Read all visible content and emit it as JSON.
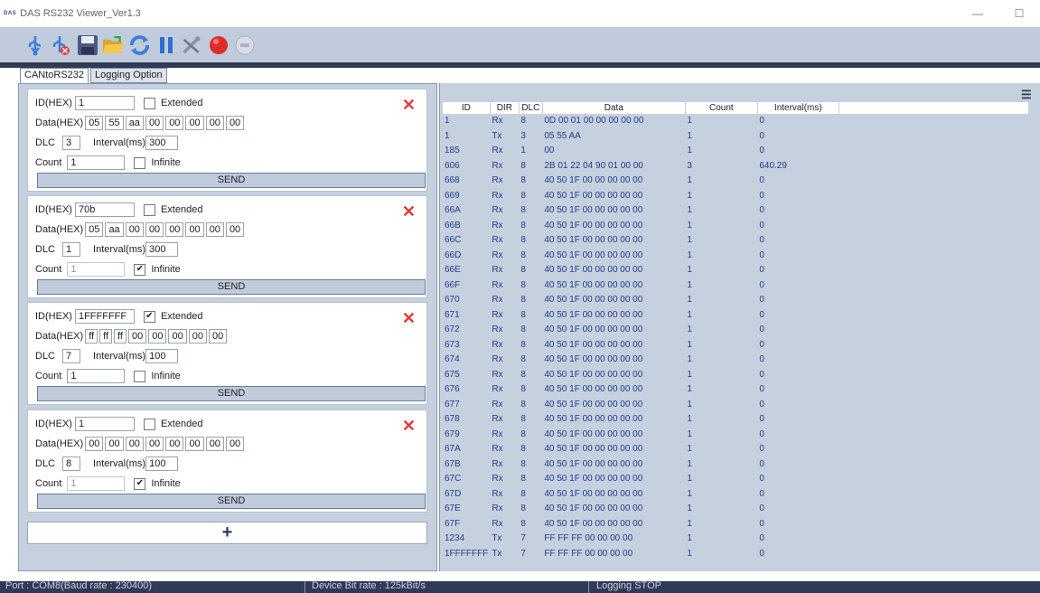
{
  "window": {
    "logo": "DAS",
    "title": "DAS RS232 Viewer_Ver1.3",
    "minimize": "—",
    "maximize": "☐"
  },
  "toolbar": {
    "items": [
      "usb-connect-icon",
      "usb-disconnect-icon",
      "save-icon",
      "open-folder-icon",
      "refresh-icon",
      "pause-icon",
      "tools-icon",
      "record-icon",
      "stop-record-icon"
    ]
  },
  "tabs": [
    "CANtoRS232",
    "Logging Option"
  ],
  "messages": [
    {
      "id_label": "ID(HEX)",
      "id": "1",
      "extended": false,
      "extended_label": "Extended",
      "data_label": "Data(HEX)",
      "data": [
        "05",
        "55",
        "aa",
        "00",
        "00",
        "00",
        "00",
        "00"
      ],
      "dlc_label": "DLC",
      "dlc": "3",
      "interval_label": "Interval(ms)",
      "interval": "300",
      "count_label": "Count",
      "count": "1",
      "infinite": false,
      "infinite_label": "Infinite",
      "send": "SEND",
      "close": "✕"
    },
    {
      "id_label": "ID(HEX)",
      "id": "70b",
      "extended": false,
      "extended_label": "Extended",
      "data_label": "Data(HEX)",
      "data": [
        "05",
        "aa",
        "00",
        "00",
        "00",
        "00",
        "00",
        "00"
      ],
      "dlc_label": "DLC",
      "dlc": "1",
      "interval_label": "Interval(ms)",
      "interval": "300",
      "count_label": "Count",
      "count": "1",
      "infinite": true,
      "infinite_label": "Infinite",
      "send": "SEND",
      "close": "✕"
    },
    {
      "id_label": "ID(HEX)",
      "id": "1FFFFFFF",
      "extended": true,
      "extended_label": "Extended",
      "data_label": "Data(HEX)",
      "data": [
        "ff",
        "ff",
        "ff",
        "00",
        "00",
        "00",
        "00",
        "00"
      ],
      "dlc_label": "DLC",
      "dlc": "7",
      "interval_label": "Interval(ms)",
      "interval": "100",
      "count_label": "Count",
      "count": "1",
      "infinite": false,
      "infinite_label": "Infinite",
      "send": "SEND",
      "close": "✕"
    },
    {
      "id_label": "ID(HEX)",
      "id": "1",
      "extended": false,
      "extended_label": "Extended",
      "data_label": "Data(HEX)",
      "data": [
        "00",
        "00",
        "00",
        "00",
        "00",
        "00",
        "00",
        "00"
      ],
      "dlc_label": "DLC",
      "dlc": "8",
      "interval_label": "Interval(ms)",
      "interval": "100",
      "count_label": "Count",
      "count": "1",
      "infinite": true,
      "infinite_label": "Infinite",
      "send": "SEND",
      "close": "✕"
    }
  ],
  "add_button": "+",
  "log": {
    "columns": [
      "ID",
      "DIR",
      "DLC",
      "Data",
      "Count",
      "Interval(ms)"
    ],
    "rows": [
      [
        "1",
        "Rx",
        "8",
        "0D 00 01 00 00 00 00 00",
        "1",
        "0"
      ],
      [
        "1",
        "Tx",
        "3",
        "05 55 AA",
        "1",
        "0"
      ],
      [
        "185",
        "Rx",
        "1",
        "00",
        "1",
        "0"
      ],
      [
        "606",
        "Rx",
        "8",
        "2B 01 22 04 90 01 00 00",
        "3",
        "640.29"
      ],
      [
        "668",
        "Rx",
        "8",
        "40 50 1F 00 00 00 00 00",
        "1",
        "0"
      ],
      [
        "669",
        "Rx",
        "8",
        "40 50 1F 00 00 00 00 00",
        "1",
        "0"
      ],
      [
        "66A",
        "Rx",
        "8",
        "40 50 1F 00 00 00 00 00",
        "1",
        "0"
      ],
      [
        "66B",
        "Rx",
        "8",
        "40 50 1F 00 00 00 00 00",
        "1",
        "0"
      ],
      [
        "66C",
        "Rx",
        "8",
        "40 50 1F 00 00 00 00 00",
        "1",
        "0"
      ],
      [
        "66D",
        "Rx",
        "8",
        "40 50 1F 00 00 00 00 00",
        "1",
        "0"
      ],
      [
        "66E",
        "Rx",
        "8",
        "40 50 1F 00 00 00 00 00",
        "1",
        "0"
      ],
      [
        "66F",
        "Rx",
        "8",
        "40 50 1F 00 00 00 00 00",
        "1",
        "0"
      ],
      [
        "670",
        "Rx",
        "8",
        "40 50 1F 00 00 00 00 00",
        "1",
        "0"
      ],
      [
        "671",
        "Rx",
        "8",
        "40 50 1F 00 00 00 00 00",
        "1",
        "0"
      ],
      [
        "672",
        "Rx",
        "8",
        "40 50 1F 00 00 00 00 00",
        "1",
        "0"
      ],
      [
        "673",
        "Rx",
        "8",
        "40 50 1F 00 00 00 00 00",
        "1",
        "0"
      ],
      [
        "674",
        "Rx",
        "8",
        "40 50 1F 00 00 00 00 00",
        "1",
        "0"
      ],
      [
        "675",
        "Rx",
        "8",
        "40 50 1F 00 00 00 00 00",
        "1",
        "0"
      ],
      [
        "676",
        "Rx",
        "8",
        "40 50 1F 00 00 00 00 00",
        "1",
        "0"
      ],
      [
        "677",
        "Rx",
        "8",
        "40 50 1F 00 00 00 00 00",
        "1",
        "0"
      ],
      [
        "678",
        "Rx",
        "8",
        "40 50 1F 00 00 00 00 00",
        "1",
        "0"
      ],
      [
        "679",
        "Rx",
        "8",
        "40 50 1F 00 00 00 00 00",
        "1",
        "0"
      ],
      [
        "67A",
        "Rx",
        "8",
        "40 50 1F 00 00 00 00 00",
        "1",
        "0"
      ],
      [
        "67B",
        "Rx",
        "8",
        "40 50 1F 00 00 00 00 00",
        "1",
        "0"
      ],
      [
        "67C",
        "Rx",
        "8",
        "40 50 1F 00 00 00 00 00",
        "1",
        "0"
      ],
      [
        "67D",
        "Rx",
        "8",
        "40 50 1F 00 00 00 00 00",
        "1",
        "0"
      ],
      [
        "67E",
        "Rx",
        "8",
        "40 50 1F 00 00 00 00 00",
        "1",
        "0"
      ],
      [
        "67F",
        "Rx",
        "8",
        "40 50 1F 00 00 00 00 00",
        "1",
        "0"
      ],
      [
        "1234",
        "Tx",
        "7",
        "FF FF FF 00 00 00 00",
        "1",
        "0"
      ],
      [
        "1FFFFFFF",
        "Tx",
        "7",
        "FF FF FF 00 00 00 00",
        "1",
        "0"
      ]
    ]
  },
  "status": {
    "port": "Port : COM8(Baud rate : 230400)",
    "device": "Device Bit rate : 125kBit/s",
    "logging": "Logging STOP"
  },
  "colors": {
    "toolbar": "#c0cbdc",
    "panel": "#c6d1e0",
    "dark": "#2f3b55",
    "log_text": "#1f3b8a",
    "close_x": "#e03a3a"
  }
}
